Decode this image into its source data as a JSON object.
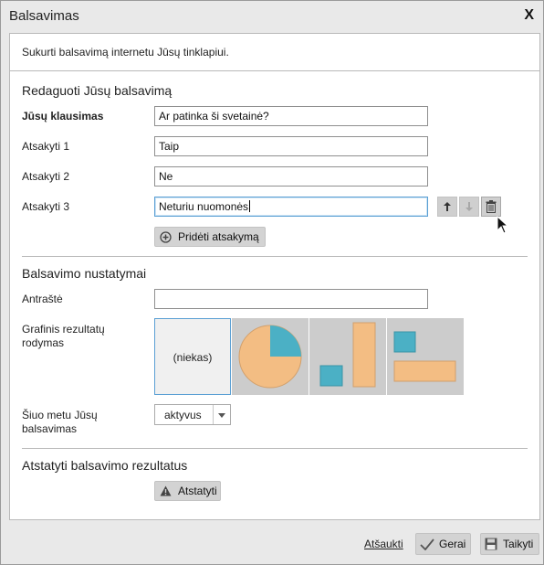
{
  "dialog": {
    "title": "Balsavimas",
    "close_label": "X"
  },
  "intro_text": "Sukurti balsavimą internetu Jūsų tinklapiui.",
  "edit_section": {
    "title": "Redaguoti Jūsų balsavimą",
    "question_label": "Jūsų klausimas",
    "question_value": "Ar patinka ši svetainė?",
    "answers": [
      {
        "label": "Atsakyti 1",
        "value": "Taip"
      },
      {
        "label": "Atsakyti 2",
        "value": "Ne"
      },
      {
        "label": "Atsakyti 3",
        "value": "Neturiu nuomonės"
      }
    ],
    "add_answer_label": "Pridėti atsakymą"
  },
  "settings_section": {
    "title": "Balsavimo nustatymai",
    "heading_label": "Antraštė",
    "heading_value": "",
    "chart_label": "Grafinis rezultatų rodymas",
    "chart_none_label": "(niekas)",
    "chart_selected": "none",
    "status_label": "Šiuo metu Jūsų balsavimas",
    "status_value": "aktyvus"
  },
  "reset_section": {
    "title": "Atstatyti balsavimo rezultatus",
    "reset_label": "Atstatyti"
  },
  "footer": {
    "cancel_label": "Atšaukti",
    "ok_label": "Gerai",
    "apply_label": "Taikyti"
  },
  "colors": {
    "chart_blue": "#4bb0c5",
    "chart_orange": "#f3bd83",
    "selection_border": "#5a9fd4"
  }
}
